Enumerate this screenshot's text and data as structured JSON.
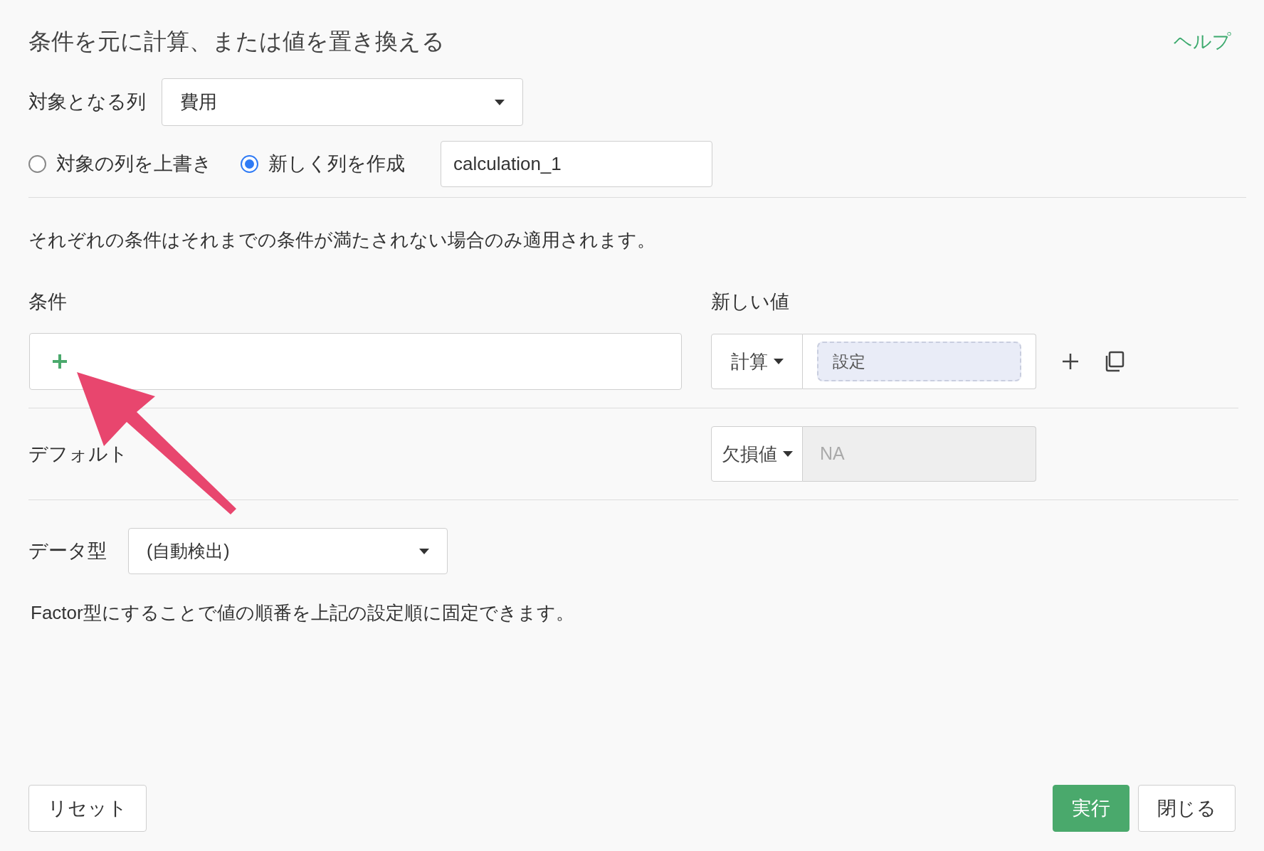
{
  "dialog": {
    "title": "条件を元に計算、または値を置き換える",
    "help_link": "ヘルプ"
  },
  "target_column": {
    "label": "対象となる列",
    "value": "費用"
  },
  "output_mode": [
    {
      "label": "対象の列を上書き",
      "selected": false
    },
    {
      "label": "新しく列を作成",
      "selected": true
    }
  ],
  "new_column_name": {
    "value": "calculation_1"
  },
  "note": "それぞれの条件はそれまでの条件が満たされない場合のみ適用されます。",
  "conditions": {
    "label": "条件",
    "value_label": "新しい値",
    "rows": [
      {
        "value_type": "計算",
        "value": "設定"
      }
    ]
  },
  "default": {
    "label": "デフォルト",
    "value_type": "欠損値",
    "value": "NA",
    "disabled": true
  },
  "data_type": {
    "label": "データ型",
    "value": "(自動検出)"
  },
  "hint": "Factor型にすることで値の順番を上記の設定順に固定できます。",
  "buttons": [
    {
      "label": "リセット",
      "kind": "secondary"
    },
    {
      "label": "実行",
      "kind": "primary"
    },
    {
      "label": "閉じる",
      "kind": "secondary"
    }
  ]
}
